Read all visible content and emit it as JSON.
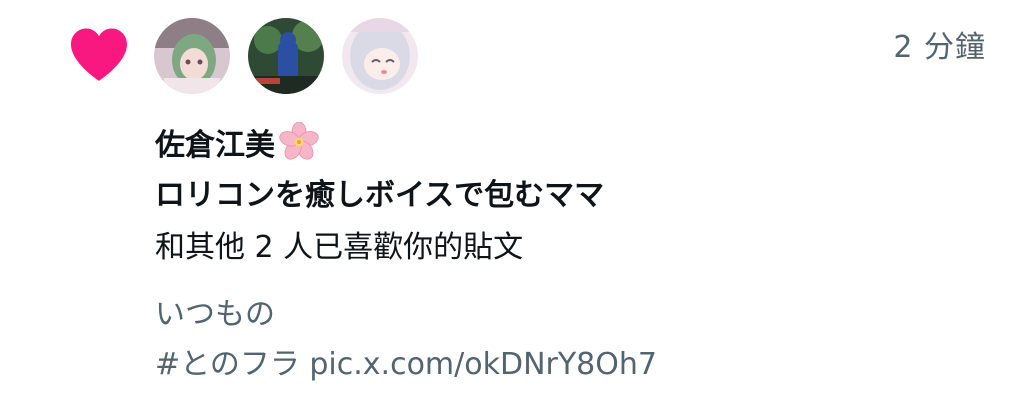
{
  "notification": {
    "timestamp": "2 分鐘",
    "user_name": "佐倉江美",
    "user_bio": "ロリコンを癒しボイスで包むママ",
    "action_text": "和其他 2 人已喜歡你的貼文",
    "post_lines": [
      "いつもの",
      "#とのフラ pic.x.com/okDNrY8Oh7"
    ],
    "heart_color": "#f91880",
    "text_color": "#0f1419",
    "muted_color": "#536471",
    "icons": {
      "like": "heart-icon",
      "name_emoji": "sakura-icon"
    }
  }
}
